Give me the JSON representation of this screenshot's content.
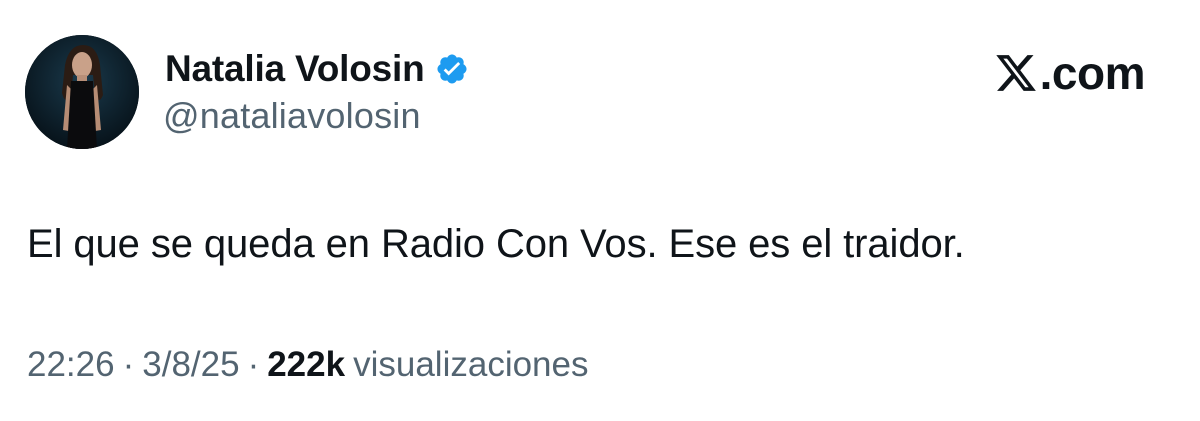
{
  "author": {
    "display_name": "Natalia Volosin",
    "handle": "@nataliavolosin",
    "verified_color": "#1d9bf0"
  },
  "brand": {
    "icon": "x-logo-icon",
    "label": ".com"
  },
  "post": {
    "text": "El que se queda en Radio Con Vos. Ese es el traidor."
  },
  "meta": {
    "time": "22:26",
    "separator": "·",
    "date": "3/8/25",
    "views_count": "222k",
    "views_label": "visualizaciones"
  },
  "colors": {
    "text_primary": "#0f1419",
    "text_secondary": "#536471",
    "accent": "#1d9bf0",
    "background": "#ffffff"
  }
}
